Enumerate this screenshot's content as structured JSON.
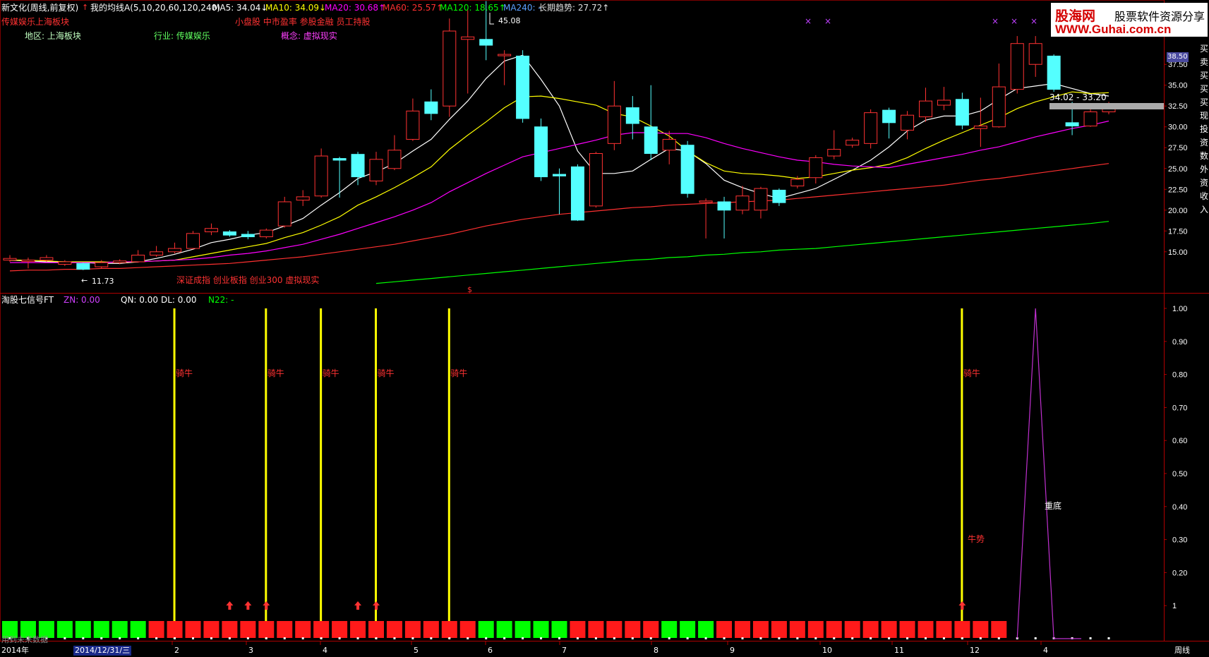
{
  "header": {
    "stock_title": "新文化(周线,前复权)",
    "indicator_name": "我的均线A(5,10,20,60,120,240)",
    "ma5": "MA5: 34.04↓",
    "ma10": "MA10: 34.09↓",
    "ma20": "MA20: 30.68↑",
    "ma60": "MA60: 25.57↑",
    "ma120": "MA120: 18.65↑",
    "ma240": "MA240: -",
    "trend": "长期趋势: 27.72↑",
    "sector_left": "传媒娱乐上海板块",
    "concept_top": "小盘股 中市盈率 参股金融 员工持股",
    "region": "地区: 上海板块",
    "industry": "行业: 传媒娱乐",
    "concept": "概念: 虚拟现实",
    "indices_note": "深证成指 创业板指 创业300 虚拟现实",
    "max_label": "45.08",
    "min_label": "11.73",
    "range_label": "34.02 - 33.20",
    "price_tag": "38.50",
    "dollar_marker": "$",
    "x_markers": [
      "×",
      "×",
      "×",
      "×",
      "×",
      "×"
    ]
  },
  "lower_header": {
    "title": "淘股七信号FT",
    "zn": "ZN: 0.00",
    "qn": "QN: 0.00",
    "dl": "DL: 0.00",
    "n22": "N22: -",
    "bottom_note": "用到未来数据"
  },
  "right_edge_text": "买卖买买买现投资数外资收入",
  "watermark": {
    "brand": "股海网",
    "slogan": "股票软件资源分享",
    "url": "WWW.Guhai.com.cn"
  },
  "footer": {
    "year": "2014年",
    "cursor_date": "2014/12/31/三",
    "months": [
      "2",
      "3",
      "4",
      "5",
      "6",
      "7",
      "8",
      "9",
      "10",
      "11",
      "12",
      "4"
    ],
    "period": "周线"
  },
  "colors": {
    "up": "#ff3232",
    "down": "#54ffff",
    "ma5": "#ffffff",
    "ma10": "#ffff00",
    "ma20": "#ff00ff",
    "ma60": "#ff3030",
    "ma120": "#00ff00",
    "signal_bar": "#ffff00",
    "tri": "#c030d0"
  },
  "chart_data": [
    {
      "type": "candlestick",
      "ylim": [
        11,
        41.5
      ],
      "y_ticks": [
        15.0,
        17.5,
        20.0,
        22.5,
        25.0,
        27.5,
        30.0,
        32.5,
        35.0,
        37.5
      ],
      "y_tick_labels": [
        "15.00",
        "17.50",
        "20.00",
        "22.50",
        "25.00",
        "27.50",
        "30.00",
        "32.50",
        "35.00",
        "37.50"
      ],
      "candles": [
        [
          14.0,
          14.2,
          14.6,
          13.8
        ],
        [
          14.0,
          14.0,
          14.3,
          13.0
        ],
        [
          14.0,
          14.3,
          14.6,
          13.8
        ],
        [
          13.5,
          13.8,
          14.0,
          13.3
        ],
        [
          13.6,
          12.9,
          13.7,
          12.8
        ],
        [
          13.2,
          13.7,
          14.0,
          13.0
        ],
        [
          13.7,
          13.9,
          14.1,
          13.5
        ],
        [
          13.8,
          14.6,
          15.2,
          13.7
        ],
        [
          14.6,
          15.0,
          15.7,
          14.4
        ],
        [
          15.0,
          15.4,
          16.1,
          14.8
        ],
        [
          15.4,
          17.2,
          17.5,
          15.3
        ],
        [
          17.4,
          17.8,
          18.4,
          17.0
        ],
        [
          17.4,
          17.0,
          17.6,
          16.8
        ],
        [
          17.1,
          16.8,
          17.5,
          16.5
        ],
        [
          16.8,
          17.6,
          17.8,
          16.6
        ],
        [
          18.1,
          21.0,
          21.6,
          17.9
        ],
        [
          21.2,
          21.6,
          22.4,
          20.5
        ],
        [
          21.7,
          26.5,
          27.4,
          21.5
        ],
        [
          26.2,
          26.0,
          26.4,
          21.5
        ],
        [
          26.7,
          24.0,
          27.0,
          23.0
        ],
        [
          23.5,
          26.1,
          27.0,
          23.0
        ],
        [
          25.0,
          27.2,
          29.0,
          24.8
        ],
        [
          28.5,
          31.9,
          33.4,
          28.3
        ],
        [
          33.0,
          31.6,
          34.5,
          30.8
        ],
        [
          32.5,
          41.5,
          43.0,
          31.2
        ],
        [
          40.5,
          40.8,
          44.0,
          34.0
        ],
        [
          40.5,
          39.8,
          45.1,
          38.0
        ],
        [
          38.7,
          38.7,
          39.2,
          35.0
        ],
        [
          38.5,
          31.0,
          39.2,
          30.5
        ],
        [
          30.0,
          24.0,
          31.0,
          23.5
        ],
        [
          24.3,
          24.1,
          25.0,
          19.5
        ],
        [
          25.2,
          18.8,
          25.5,
          18.7
        ],
        [
          20.5,
          26.8,
          27.0,
          20.3
        ],
        [
          28.0,
          32.5,
          35.5,
          27.2
        ],
        [
          32.3,
          30.4,
          33.7,
          28.5
        ],
        [
          30.0,
          26.8,
          35.0,
          26.0
        ],
        [
          27.2,
          28.5,
          29.5,
          25.5
        ],
        [
          27.8,
          22.0,
          28.3,
          21.5
        ],
        [
          21.0,
          21.1,
          21.4,
          16.6
        ],
        [
          21.0,
          20.0,
          21.6,
          16.6
        ],
        [
          20.0,
          21.7,
          22.9,
          19.5
        ],
        [
          20.0,
          22.6,
          22.8,
          19.0
        ],
        [
          22.4,
          20.9,
          22.6,
          20.5
        ],
        [
          22.9,
          23.7,
          24.1,
          22.6
        ],
        [
          23.9,
          26.3,
          26.6,
          23.2
        ],
        [
          26.5,
          27.3,
          29.6,
          26.1
        ],
        [
          27.8,
          28.4,
          28.7,
          27.5
        ],
        [
          28.0,
          31.7,
          32.1,
          27.4
        ],
        [
          32.0,
          30.5,
          32.3,
          28.6
        ],
        [
          29.6,
          31.4,
          31.9,
          28.5
        ],
        [
          31.2,
          33.1,
          34.7,
          30.6
        ],
        [
          32.6,
          33.2,
          34.8,
          32.0
        ],
        [
          33.3,
          30.2,
          34.1,
          29.7
        ],
        [
          29.8,
          30.1,
          33.5,
          27.6
        ],
        [
          30.0,
          34.8,
          37.6,
          29.9
        ],
        [
          34.5,
          40.0,
          40.9,
          34.0
        ],
        [
          37.5,
          40.0,
          40.9,
          36.0
        ],
        [
          38.5,
          34.5,
          38.7,
          34.2
        ],
        [
          30.5,
          30.1,
          33.0,
          29.0
        ],
        [
          30.1,
          31.8,
          32.5,
          30.0
        ],
        [
          31.8,
          32.5,
          33.0,
          31.5
        ]
      ],
      "series": [
        {
          "name": "MA5",
          "values": [
            14.0,
            13.9,
            13.8,
            13.8,
            13.7,
            13.6,
            13.6,
            13.8,
            14.2,
            14.7,
            15.3,
            16.1,
            16.5,
            17.0,
            17.3,
            18.1,
            19.0,
            20.6,
            22.1,
            23.8,
            24.6,
            25.6,
            27.1,
            28.5,
            30.9,
            33.1,
            35.8,
            37.9,
            38.6,
            35.7,
            32.5,
            27.1,
            24.4,
            24.4,
            24.7,
            26.1,
            27.4,
            27.1,
            25.6,
            23.6,
            22.7,
            22.0,
            21.4,
            22.0,
            22.6,
            23.7,
            24.8,
            26.0,
            27.6,
            29.5,
            30.8,
            31.3,
            31.3,
            31.9,
            33.3,
            34.6,
            34.9,
            35.2,
            34.6,
            34.0,
            33.7
          ]
        },
        {
          "name": "MA10",
          "values": [
            14.0,
            14.0,
            13.9,
            13.8,
            13.8,
            13.8,
            13.7,
            13.8,
            13.9,
            14.0,
            14.4,
            14.8,
            15.2,
            15.6,
            16.0,
            16.7,
            17.3,
            18.2,
            19.2,
            20.6,
            21.6,
            22.7,
            23.9,
            25.2,
            27.3,
            29.0,
            30.6,
            32.3,
            33.6,
            33.7,
            33.4,
            33.0,
            32.6,
            31.6,
            31.2,
            30.1,
            28.9,
            27.1,
            25.7,
            24.7,
            24.4,
            24.3,
            24.1,
            23.8,
            24.0,
            24.4,
            24.8,
            25.1,
            25.5,
            26.3,
            27.4,
            28.4,
            29.3,
            30.2,
            31.1,
            32.2,
            33.0,
            33.6,
            34.2,
            34.0,
            34.1
          ]
        },
        {
          "name": "MA20",
          "values": [
            13.7,
            13.7,
            13.7,
            13.7,
            13.7,
            13.7,
            13.8,
            13.8,
            13.9,
            14.0,
            14.1,
            14.3,
            14.6,
            14.8,
            15.1,
            15.5,
            15.9,
            16.5,
            17.1,
            17.8,
            18.5,
            19.2,
            20.0,
            20.9,
            22.2,
            23.3,
            24.4,
            25.4,
            26.4,
            26.9,
            27.4,
            27.9,
            28.4,
            29.0,
            29.3,
            29.3,
            29.2,
            29.2,
            28.7,
            28.0,
            27.4,
            26.9,
            26.4,
            26.0,
            25.8,
            25.5,
            25.3,
            25.2,
            25.1,
            25.5,
            25.9,
            26.3,
            26.7,
            27.2,
            27.6,
            28.2,
            28.8,
            29.3,
            29.8,
            30.2,
            30.7
          ]
        },
        {
          "name": "MA60",
          "values": [
            12.7,
            12.8,
            12.8,
            12.9,
            12.9,
            13.0,
            13.0,
            13.1,
            13.2,
            13.3,
            13.4,
            13.5,
            13.6,
            13.8,
            14.0,
            14.2,
            14.4,
            14.7,
            15.0,
            15.3,
            15.6,
            15.9,
            16.3,
            16.7,
            17.1,
            17.6,
            18.1,
            18.5,
            18.9,
            19.2,
            19.5,
            19.7,
            19.9,
            20.1,
            20.3,
            20.4,
            20.6,
            20.7,
            20.8,
            20.9,
            21.0,
            21.1,
            21.2,
            21.4,
            21.6,
            21.8,
            22.0,
            22.2,
            22.4,
            22.6,
            22.8,
            23.0,
            23.3,
            23.6,
            23.8,
            24.1,
            24.4,
            24.7,
            25.0,
            25.3,
            25.6
          ]
        },
        {
          "name": "MA120",
          "values": [
            null,
            null,
            null,
            null,
            null,
            null,
            null,
            null,
            null,
            null,
            null,
            null,
            null,
            null,
            null,
            null,
            null,
            null,
            null,
            null,
            11.2,
            11.4,
            11.6,
            11.8,
            12.0,
            12.2,
            12.4,
            12.6,
            12.8,
            13.0,
            13.2,
            13.4,
            13.6,
            13.8,
            14.0,
            14.1,
            14.3,
            14.4,
            14.6,
            14.7,
            14.9,
            15.0,
            15.2,
            15.3,
            15.4,
            15.6,
            15.8,
            16.0,
            16.2,
            16.4,
            16.6,
            16.8,
            17.0,
            17.2,
            17.4,
            17.6,
            17.8,
            18.0,
            18.2,
            18.4,
            18.65
          ]
        }
      ]
    },
    {
      "type": "bar",
      "ylim": [
        0,
        1.0
      ],
      "y_ticks": [
        0.1,
        0.2,
        0.3,
        0.4,
        0.5,
        0.6,
        0.7,
        0.8,
        0.9,
        1.0
      ],
      "y_tick_labels": [
        "1",
        "0.20",
        "0.30",
        "0.40",
        "0.50",
        "0.60",
        "0.70",
        "0.80",
        "0.90",
        "1.00"
      ],
      "signal_label": "骑牛",
      "trend_label": "牛势",
      "bottom_label": "重底",
      "signals": [
        9,
        14,
        17,
        20,
        24,
        52
      ],
      "arrows": [
        12,
        13,
        14,
        19,
        20,
        52
      ],
      "status": [
        "g",
        "g",
        "g",
        "g",
        "g",
        "g",
        "g",
        "g",
        "r",
        "r",
        "r",
        "r",
        "r",
        "r",
        "r",
        "r",
        "r",
        "r",
        "r",
        "r",
        "r",
        "r",
        "r",
        "r",
        "r",
        "r",
        "g",
        "g",
        "g",
        "g",
        "g",
        "r",
        "r",
        "r",
        "r",
        "r",
        "g",
        "g",
        "g",
        "r",
        "r",
        "r",
        "r",
        "r",
        "r",
        "r",
        "r",
        "r",
        "r",
        "r",
        "r",
        "r",
        "r",
        "r",
        "r",
        "n",
        "n",
        "n",
        "n",
        "n",
        "n"
      ],
      "triangle": {
        "start": 55,
        "peak": 56,
        "end": 57
      }
    }
  ]
}
